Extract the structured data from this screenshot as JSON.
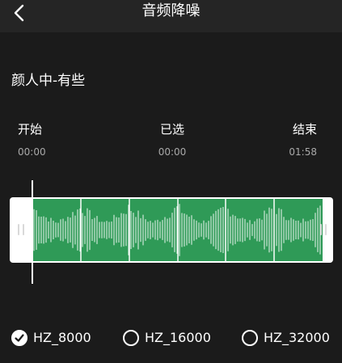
{
  "header": {
    "title": "音频降噪",
    "back_icon": "chevron-left-icon"
  },
  "song": {
    "title": "颜人中-有些"
  },
  "selection": {
    "start": {
      "label": "开始",
      "time": "00:00"
    },
    "selected": {
      "label": "已选",
      "time": "00:00"
    },
    "end": {
      "label": "结束",
      "time": "01:58"
    }
  },
  "waveform": {
    "color": "#2f9a57",
    "frame_color": "#ffffff",
    "playhead_position": 0.0
  },
  "sample_rates": {
    "selected": "HZ_8000",
    "options": [
      {
        "label": "HZ_8000",
        "checked": true
      },
      {
        "label": "HZ_16000",
        "checked": false
      },
      {
        "label": "HZ_32000",
        "checked": false
      }
    ]
  }
}
